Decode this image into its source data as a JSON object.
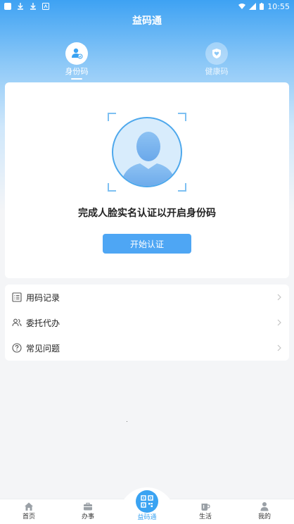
{
  "status_bar": {
    "time": "10:55",
    "left_icons": [
      "app-icon",
      "download-icon",
      "download-icon",
      "notification-icon"
    ],
    "right_icons": [
      "wifi-icon",
      "signal-icon",
      "battery-icon"
    ]
  },
  "header": {
    "title": "益码通"
  },
  "tabs": [
    {
      "label": "身份码",
      "icon": "id-card-icon",
      "active": true
    },
    {
      "label": "健康码",
      "icon": "health-shield-icon",
      "active": false
    }
  ],
  "card": {
    "prompt": "完成人脸实名认证以开启身份码",
    "button_label": "开始认证"
  },
  "menu": [
    {
      "label": "用码记录",
      "icon": "list-icon"
    },
    {
      "label": "委托代办",
      "icon": "users-icon"
    },
    {
      "label": "常见问题",
      "icon": "question-icon"
    }
  ],
  "bottom_nav": [
    {
      "label": "首页",
      "icon": "home-icon"
    },
    {
      "label": "办事",
      "icon": "briefcase-icon"
    },
    {
      "label": "益码通",
      "icon": "qr-code-icon",
      "active": true
    },
    {
      "label": "生活",
      "icon": "cup-icon"
    },
    {
      "label": "我的",
      "icon": "user-icon"
    }
  ],
  "colors": {
    "accent": "#3aa3f2",
    "button": "#4ea6f4",
    "header_gradient_top": "#3ea2f3"
  }
}
